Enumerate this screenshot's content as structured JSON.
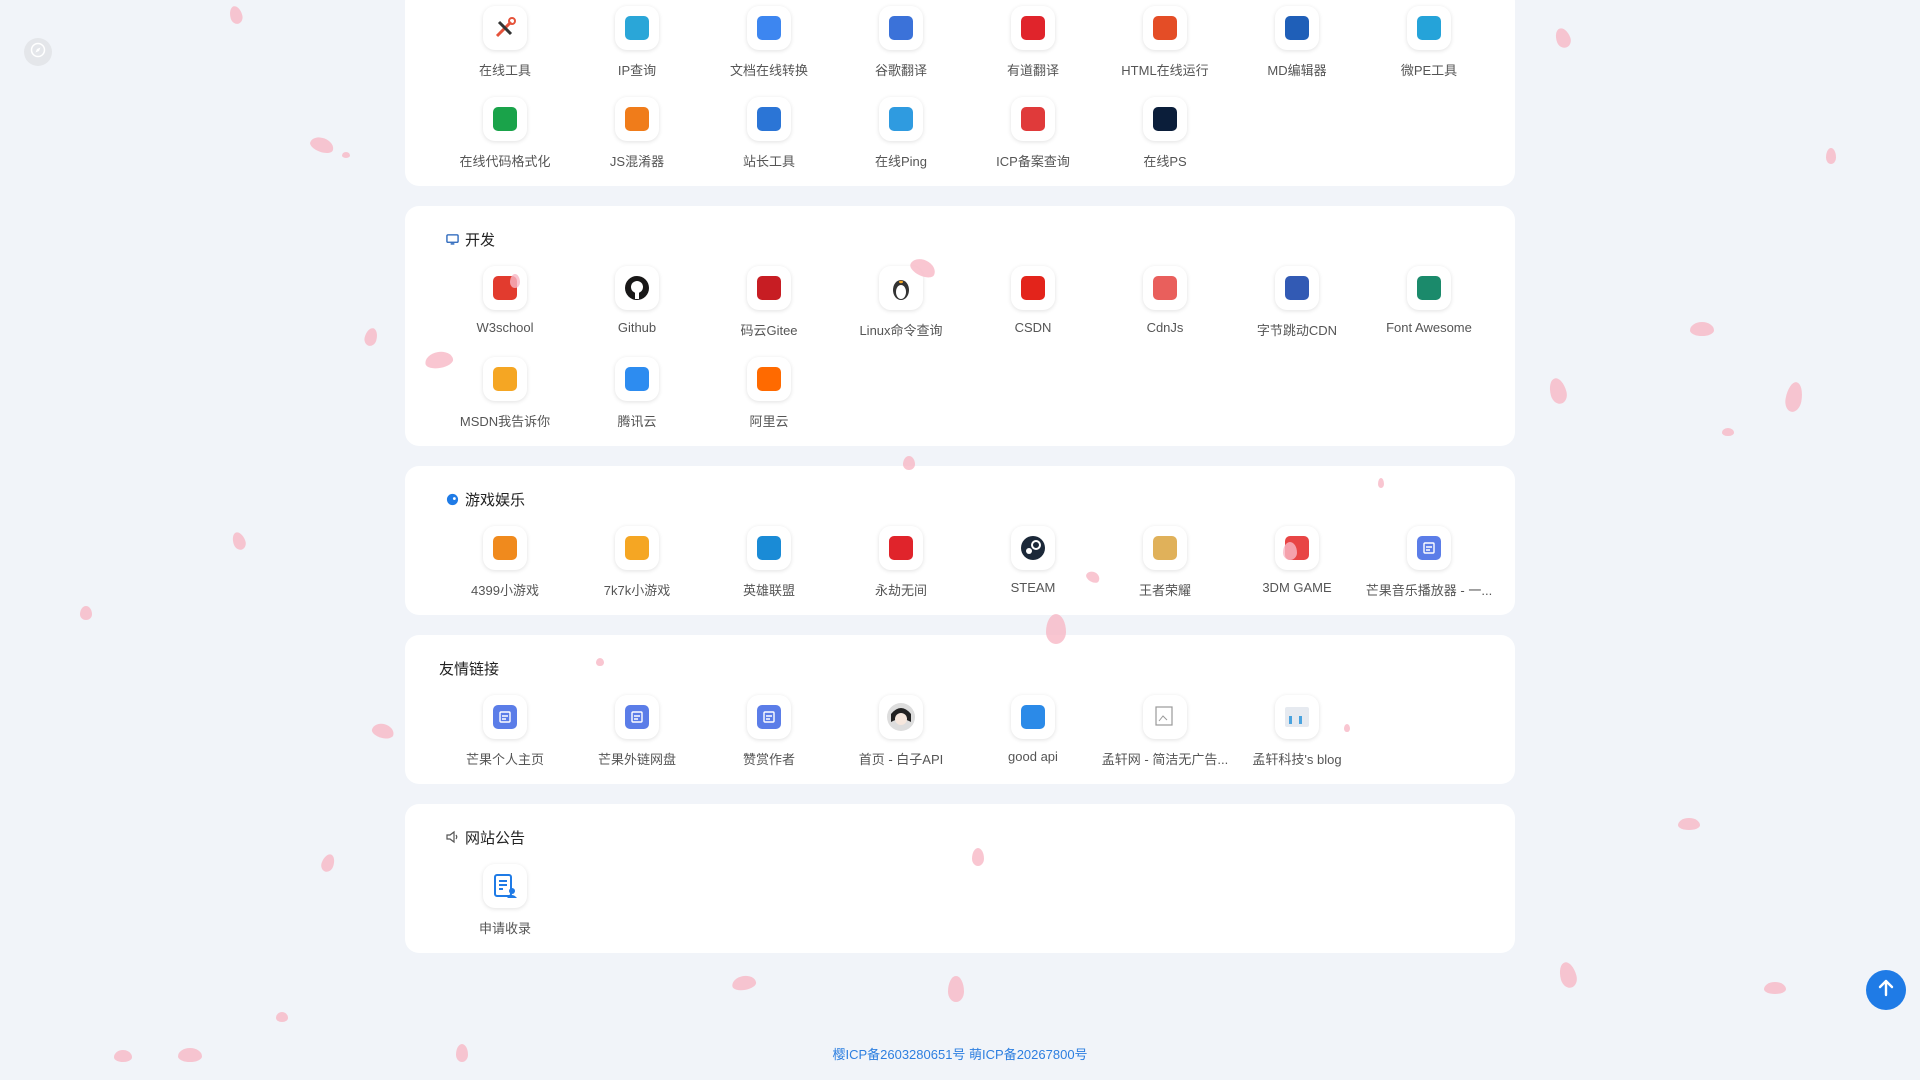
{
  "sections": [
    {
      "title": "",
      "icon": "",
      "items": [
        {
          "label": "在线工具",
          "icon": "tools-icon",
          "color": "#e5533b"
        },
        {
          "label": "IP查询",
          "icon": "ip-icon",
          "color": "#2aa6d8"
        },
        {
          "label": "文档在线转换",
          "icon": "doc-convert-icon",
          "color": "#3d86f0"
        },
        {
          "label": "谷歌翻译",
          "icon": "translate-icon",
          "color": "#3b72d9"
        },
        {
          "label": "有道翻译",
          "icon": "youdao-icon",
          "color": "#e0242b"
        },
        {
          "label": "HTML在线运行",
          "icon": "html5-icon",
          "color": "#e44d26"
        },
        {
          "label": "MD编辑器",
          "icon": "markdown-icon",
          "color": "#1f5fb8"
        },
        {
          "label": "微PE工具",
          "icon": "pe-icon",
          "color": "#25a3d9"
        },
        {
          "label": "在线代码格式化",
          "icon": "terminal-icon",
          "color": "#1aa34a"
        },
        {
          "label": "JS混淆器",
          "icon": "lock-icon",
          "color": "#f07c1a"
        },
        {
          "label": "站长工具",
          "icon": "webmaster-icon",
          "color": "#2b75d6"
        },
        {
          "label": "在线Ping",
          "icon": "network-icon",
          "color": "#2f9be0"
        },
        {
          "label": "ICP备案查询",
          "icon": "icp-shield-icon",
          "color": "#e03a3a"
        },
        {
          "label": "在线PS",
          "icon": "photoshop-icon",
          "color": "#0b1e3a"
        }
      ]
    },
    {
      "title": "开发",
      "icon": "monitor-icon",
      "items": [
        {
          "label": "W3school",
          "icon": "html5-icon",
          "color": "#e23b2e"
        },
        {
          "label": "Github",
          "icon": "github-icon",
          "color": "#181717"
        },
        {
          "label": "码云Gitee",
          "icon": "gitee-icon",
          "color": "#c71d23"
        },
        {
          "label": "Linux命令查询",
          "icon": "linux-icon",
          "color": "#333333"
        },
        {
          "label": "CSDN",
          "icon": "csdn-icon",
          "color": "#e3241b"
        },
        {
          "label": "CdnJs",
          "icon": "cdnjs-icon",
          "color": "#e95f5c"
        },
        {
          "label": "字节跳动CDN",
          "icon": "bytedance-icon",
          "color": "#325ab4"
        },
        {
          "label": "Font Awesome",
          "icon": "flag-icon",
          "color": "#1b8a6b"
        },
        {
          "label": "MSDN我告诉你",
          "icon": "msdn-icon",
          "color": "#f5a623"
        },
        {
          "label": "腾讯云",
          "icon": "cloud-icon",
          "color": "#2d8cf0"
        },
        {
          "label": "阿里云",
          "icon": "aliyun-icon",
          "color": "#ff6a00"
        }
      ]
    },
    {
      "title": "游戏娱乐",
      "icon": "game-icon",
      "items": [
        {
          "label": "4399小游戏",
          "icon": "4399-icon",
          "color": "#f08a1d"
        },
        {
          "label": "7k7k小游戏",
          "icon": "7k7k-icon",
          "color": "#f5a623"
        },
        {
          "label": "英雄联盟",
          "icon": "lol-icon",
          "color": "#1a8bd6"
        },
        {
          "label": "永劫无间",
          "icon": "naraka-icon",
          "color": "#e0242b"
        },
        {
          "label": "STEAM",
          "icon": "steam-icon",
          "color": "#1b2838"
        },
        {
          "label": "王者荣耀",
          "icon": "honor-icon",
          "color": "#e0b15a"
        },
        {
          "label": "3DM GAME",
          "icon": "3dm-icon",
          "color": "#e84545"
        },
        {
          "label": "芒果音乐播放器 - 一...",
          "icon": "bookmark-icon",
          "color": "#5b7de8"
        }
      ]
    },
    {
      "title": "友情链接",
      "icon": "",
      "items": [
        {
          "label": "芒果个人主页",
          "icon": "bookmark-icon",
          "color": "#5b7de8"
        },
        {
          "label": "芒果外链网盘",
          "icon": "bookmark-icon",
          "color": "#5b7de8"
        },
        {
          "label": "赞赏作者",
          "icon": "bookmark-icon",
          "color": "#5b7de8"
        },
        {
          "label": "首页 - 白子API",
          "icon": "avatar-icon",
          "color": "#333333"
        },
        {
          "label": "good api",
          "icon": "api-icon",
          "color": "#2b8ae8"
        },
        {
          "label": "孟轩网 - 简洁无广告...",
          "icon": "broken-image-icon",
          "color": "#999999"
        },
        {
          "label": "孟轩科技's blog",
          "icon": "blog-icon",
          "color": "#9aa6b8"
        }
      ]
    },
    {
      "title": "网站公告",
      "icon": "speaker-icon",
      "items": [
        {
          "label": "申请收录",
          "icon": "apply-doc-icon",
          "color": "#1f7be6"
        }
      ]
    }
  ],
  "footer": {
    "text": "樱ICP备2603280651号 萌ICP备20267800号"
  },
  "colors": {
    "background": "#f1f4f9",
    "card": "#ffffff",
    "accent": "#1f7be6",
    "petal": "#f7b8c6"
  }
}
